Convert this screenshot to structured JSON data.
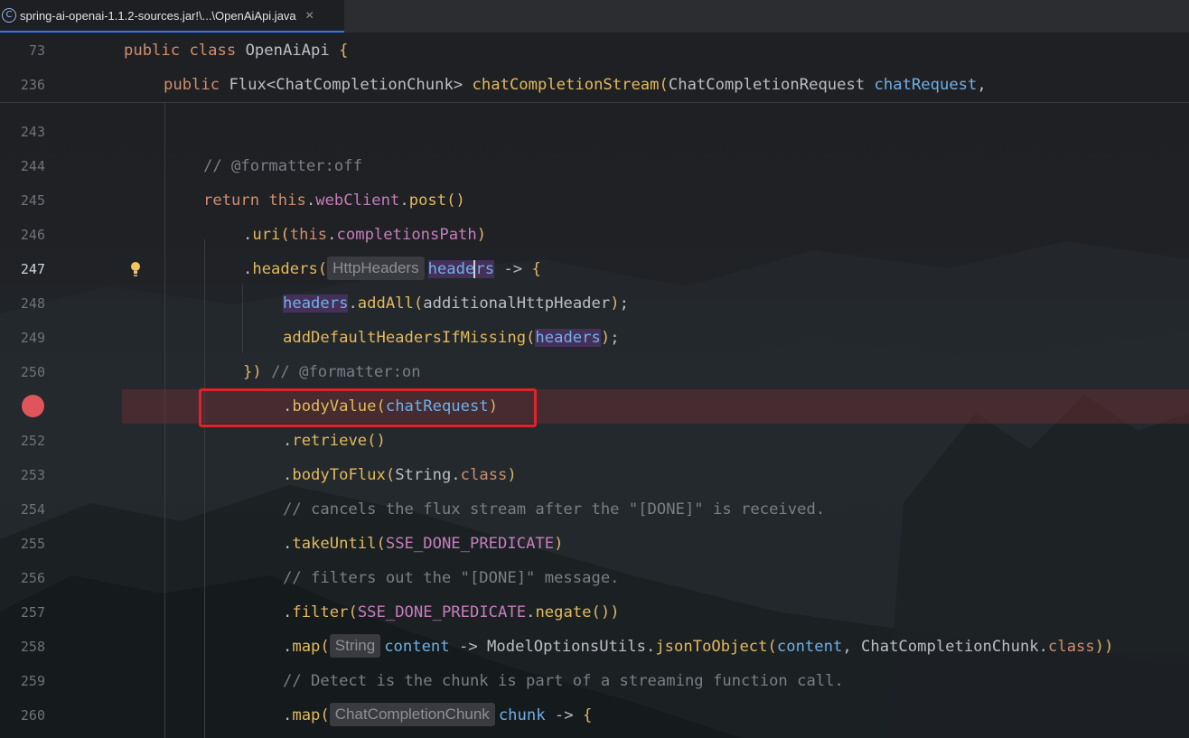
{
  "tab": {
    "icon": "java-class-icon",
    "icon_glyph": "C",
    "title": "spring-ai-openai-1.1.2-sources.jar!\\...\\OpenAiApi.java",
    "close_glyph": "✕"
  },
  "editor": {
    "sticky": [
      {
        "line": "73"
      },
      {
        "line": "236"
      }
    ],
    "lines": {
      "l243": "243",
      "l244": "244",
      "l245": "245",
      "l246": "246",
      "l247": "247",
      "l248": "248",
      "l249": "249",
      "l250": "250",
      "l252": "252",
      "l253": "253",
      "l254": "254",
      "l255": "255",
      "l256": "256",
      "l257": "257",
      "l258": "258",
      "l259": "259",
      "l260": "260"
    },
    "tokens": {
      "public": "public",
      "class": "class",
      "class_name": "OpenAiApi",
      "brace_open": "{",
      "flux": "Flux",
      "lt": "<",
      "chunk_type": "ChatCompletionChunk",
      "gt": ">",
      "stream_method": "chatCompletionStream",
      "paren_open": "(",
      "request_type": "ChatCompletionRequest",
      "chat_request": "chatRequest",
      "comma": ",",
      "formatter_off": "// @formatter:off",
      "return": "return",
      "this": "this",
      "dot": ".",
      "web_client": "webClient",
      "post": "post",
      "parens": "()",
      "uri": "uri",
      "completions_path": "completionsPath",
      "paren_close": ")",
      "headers_method": "headers",
      "hint_http_headers": "HttpHeaders",
      "headers_param_a": "heade",
      "headers_param_b": "rs",
      "arrow": "->",
      "headers_var": "headers",
      "add_all": "addAll",
      "additional_header": "additionalHttpHeader",
      "semicolon": ";",
      "add_default": "addDefaultHeadersIfMissing",
      "close_lambda": "})",
      "formatter_on": "// @formatter:on",
      "body_value": "bodyValue",
      "retrieve": "retrieve",
      "body_to_flux": "bodyToFlux",
      "string_type": "String",
      "comment_cancels": "// cancels the flux stream after the \"[DONE]\" is received.",
      "take_until": "takeUntil",
      "done_predicate": "SSE_DONE_PREDICATE",
      "comment_filters": "// filters out the \"[DONE]\" message.",
      "filter": "filter",
      "negate": "negate",
      "map": "map",
      "hint_string": "String",
      "content": "content",
      "utils": "ModelOptionsUtils",
      "json_to_object": "jsonToObject",
      "comment_detect": "// Detect is the chunk is part of a streaming function call.",
      "hint_chunk": "ChatCompletionChunk",
      "chunk_var": "chunk"
    }
  },
  "colors": {
    "keyword": "#cf8e6d",
    "method": "#56a8f5",
    "field": "#c77dbb",
    "comment": "#7a7e85",
    "breakpoint": "#e0555c",
    "highlight_box": "#e0232b",
    "caret": "#cfd1d6"
  }
}
